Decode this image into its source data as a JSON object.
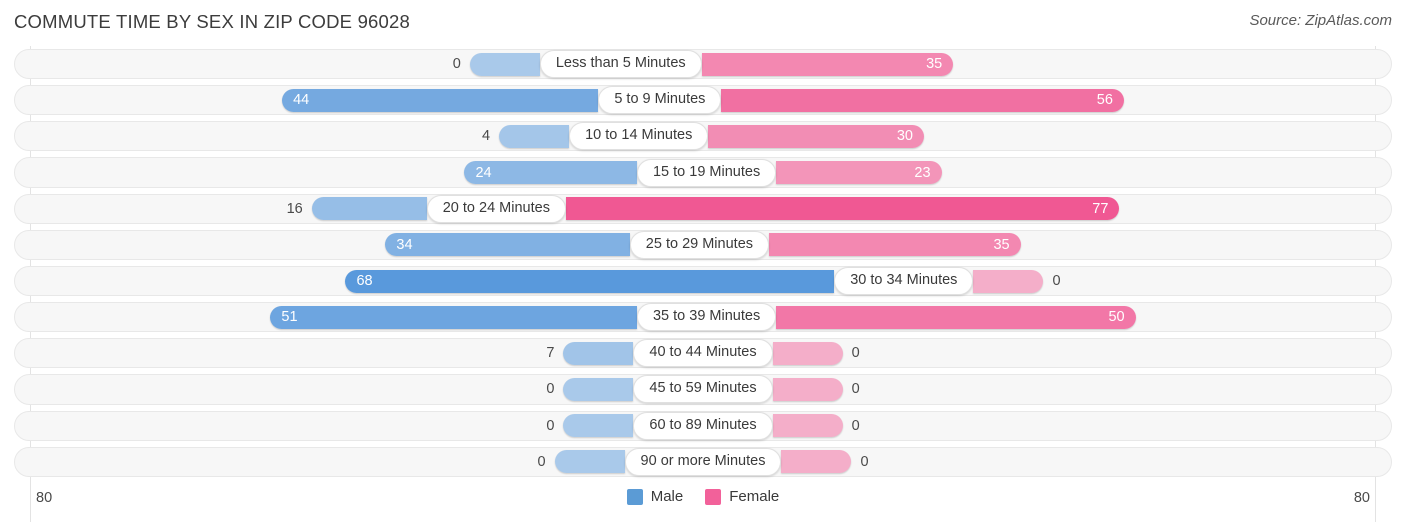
{
  "header": {
    "title": "COMMUTE TIME BY SEX IN ZIP CODE 96028",
    "source": "Source: ZipAtlas.com"
  },
  "footer": {
    "axis_left": "80",
    "axis_right": "80"
  },
  "legend": {
    "items": [
      {
        "label": "Male",
        "color": "#5b9bd5"
      },
      {
        "label": "Female",
        "color": "#f2619a"
      }
    ]
  },
  "colors": {
    "male": "#5b9bd5",
    "female": "#f2619a",
    "track": "#f7f7f7",
    "track_border": "#e8e8e8",
    "axis_rule": "#e3e3e3"
  },
  "chart_data": {
    "type": "bar",
    "orientation": "horizontal",
    "layout": "diverging-bidirectional",
    "title": "COMMUTE TIME BY SEX IN ZIP CODE 96028",
    "source": "Source: ZipAtlas.com",
    "xlabel": "",
    "ylabel": "",
    "xlim": [
      80,
      80
    ],
    "axis_left_max": 80,
    "axis_right_max": 80,
    "grid": false,
    "legend_position": "bottom-center",
    "categories": [
      "Less than 5 Minutes",
      "5 to 9 Minutes",
      "10 to 14 Minutes",
      "15 to 19 Minutes",
      "20 to 24 Minutes",
      "25 to 29 Minutes",
      "30 to 34 Minutes",
      "35 to 39 Minutes",
      "40 to 44 Minutes",
      "45 to 59 Minutes",
      "60 to 89 Minutes",
      "90 or more Minutes"
    ],
    "series": [
      {
        "name": "Male",
        "color": "#5b9bd5",
        "side": "left",
        "values": [
          0,
          44,
          4,
          24,
          16,
          34,
          68,
          51,
          7,
          0,
          0,
          0
        ]
      },
      {
        "name": "Female",
        "color": "#f2619a",
        "side": "right",
        "values": [
          35,
          56,
          30,
          23,
          77,
          35,
          0,
          50,
          0,
          0,
          0,
          0
        ]
      }
    ]
  }
}
